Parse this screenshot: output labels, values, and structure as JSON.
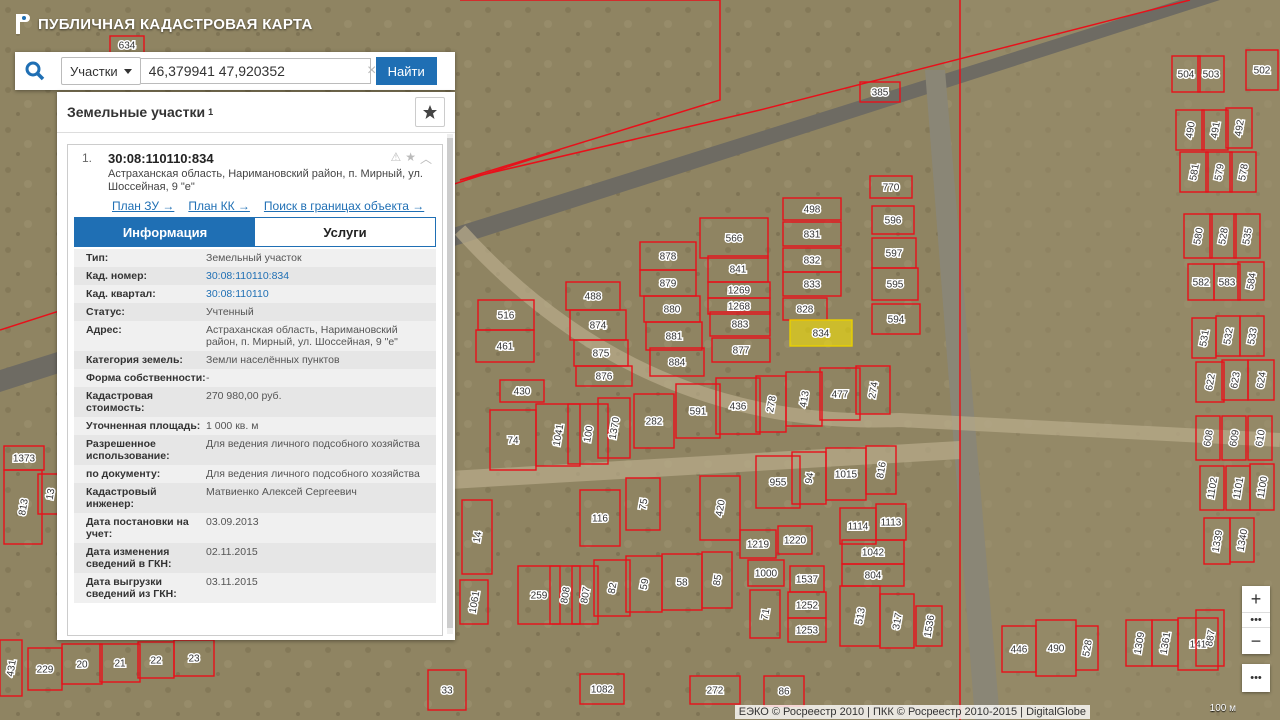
{
  "app": {
    "title": "ПУБЛИЧНАЯ КАДАСТРОВАЯ КАРТА"
  },
  "search": {
    "type_label": "Участки",
    "query": "46,379941 47,920352",
    "button": "Найти"
  },
  "panel": {
    "title": "Земельные участки",
    "count": "1",
    "result": {
      "index": "1.",
      "cad_number": "30:08:110110:834",
      "address": "Астраханская область, Наримановский район, п. Мирный, ул. Шоссейная, 9 \"е\"",
      "links": [
        "План ЗУ →",
        "План КК →",
        "Поиск в границах объекта →"
      ],
      "tabs": [
        "Информация",
        "Услуги"
      ],
      "rows": [
        {
          "k": "Тип:",
          "v": "Земельный участок"
        },
        {
          "k": "Кад. номер:",
          "v": "30:08:110110:834",
          "link": true
        },
        {
          "k": "Кад. квартал:",
          "v": "30:08:110110",
          "link": true
        },
        {
          "k": "Статус:",
          "v": "Учтенный"
        },
        {
          "k": "Адрес:",
          "v": "Астраханская область, Наримановский район, п. Мирный, ул. Шоссейная, 9 \"е\""
        },
        {
          "k": "Категория земель:",
          "v": "Земли населённых пунктов"
        },
        {
          "k": "Форма собственности:",
          "v": "-"
        },
        {
          "k": "Кадастровая стоимость:",
          "v": "270 980,00 руб."
        },
        {
          "k": "Уточненная площадь:",
          "v": "1 000 кв. м"
        },
        {
          "k": "Разрешенное использование:",
          "v": "Для ведения личного подсобного хозяйства"
        },
        {
          "k": "по документу:",
          "v": "Для ведения личного подсобного хозяйства"
        },
        {
          "k": "Кадастровый инженер:",
          "v": "Матвиенко Алексей Сергеевич"
        },
        {
          "k": "Дата постановки на учет:",
          "v": "03.09.2013"
        },
        {
          "k": "Дата изменения сведений в ГКН:",
          "v": "02.11.2015"
        },
        {
          "k": "Дата выгрузки сведений из ГКН:",
          "v": "03.11.2015"
        }
      ]
    }
  },
  "map": {
    "plots": [
      {
        "n": "498"
      },
      {
        "n": "831"
      },
      {
        "n": "832"
      },
      {
        "n": "833"
      },
      {
        "n": "828"
      },
      {
        "n": "834",
        "selected": true
      },
      {
        "n": "770"
      },
      {
        "n": "596"
      },
      {
        "n": "597"
      },
      {
        "n": "595"
      },
      {
        "n": "594"
      },
      {
        "n": "566"
      },
      {
        "n": "841"
      },
      {
        "n": "1269"
      },
      {
        "n": "1268"
      },
      {
        "n": "883"
      },
      {
        "n": "877"
      },
      {
        "n": "878"
      },
      {
        "n": "879"
      },
      {
        "n": "880"
      },
      {
        "n": "881"
      },
      {
        "n": "884"
      },
      {
        "n": "488"
      },
      {
        "n": "874"
      },
      {
        "n": "875"
      },
      {
        "n": "876"
      },
      {
        "n": "516"
      },
      {
        "n": "461"
      },
      {
        "n": "430"
      },
      {
        "n": "74"
      },
      {
        "n": "1041"
      },
      {
        "n": "100"
      },
      {
        "n": "1370"
      },
      {
        "n": "282"
      },
      {
        "n": "591"
      },
      {
        "n": "436"
      },
      {
        "n": "278"
      },
      {
        "n": "413"
      },
      {
        "n": "477"
      },
      {
        "n": "274"
      },
      {
        "n": "955"
      },
      {
        "n": "94"
      },
      {
        "n": "1015"
      },
      {
        "n": "816"
      },
      {
        "n": "420"
      },
      {
        "n": "116"
      },
      {
        "n": "75"
      },
      {
        "n": "1219"
      },
      {
        "n": "1220"
      },
      {
        "n": "1114"
      },
      {
        "n": "1113"
      },
      {
        "n": "1042"
      },
      {
        "n": "804"
      },
      {
        "n": "1000"
      },
      {
        "n": "1537"
      },
      {
        "n": "1252"
      },
      {
        "n": "1253"
      },
      {
        "n": "513"
      },
      {
        "n": "317"
      },
      {
        "n": "1536"
      },
      {
        "n": "71"
      },
      {
        "n": "259"
      },
      {
        "n": "808"
      },
      {
        "n": "807"
      },
      {
        "n": "82"
      },
      {
        "n": "59"
      },
      {
        "n": "58"
      },
      {
        "n": "85"
      },
      {
        "n": "14"
      },
      {
        "n": "1061"
      },
      {
        "n": "20"
      },
      {
        "n": "21"
      },
      {
        "n": "22"
      },
      {
        "n": "23"
      },
      {
        "n": "229"
      },
      {
        "n": "431"
      },
      {
        "n": "33"
      },
      {
        "n": "1082"
      },
      {
        "n": "272"
      },
      {
        "n": "86"
      },
      {
        "n": "1373"
      },
      {
        "n": "813"
      },
      {
        "n": "13"
      },
      {
        "n": "504"
      },
      {
        "n": "503"
      },
      {
        "n": "502"
      },
      {
        "n": "490"
      },
      {
        "n": "491"
      },
      {
        "n": "492"
      },
      {
        "n": "581"
      },
      {
        "n": "579"
      },
      {
        "n": "578"
      },
      {
        "n": "580"
      },
      {
        "n": "528"
      },
      {
        "n": "535"
      },
      {
        "n": "582"
      },
      {
        "n": "583"
      },
      {
        "n": "584"
      },
      {
        "n": "531"
      },
      {
        "n": "532"
      },
      {
        "n": "533"
      },
      {
        "n": "622"
      },
      {
        "n": "623"
      },
      {
        "n": "624"
      },
      {
        "n": "608"
      },
      {
        "n": "609"
      },
      {
        "n": "610"
      },
      {
        "n": "1102"
      },
      {
        "n": "1101"
      },
      {
        "n": "1100"
      },
      {
        "n": "1339"
      },
      {
        "n": "1340"
      },
      {
        "n": "446"
      },
      {
        "n": "490"
      },
      {
        "n": "528"
      },
      {
        "n": "1309"
      },
      {
        "n": "1361"
      },
      {
        "n": "141"
      },
      {
        "n": "887"
      },
      {
        "n": "385"
      },
      {
        "n": "634"
      }
    ]
  },
  "attribution": "ЕЭКО © Росреестр 2010 | ПКК © Росреестр 2010-2015 | DigitalGlobe",
  "scale": "100 м"
}
